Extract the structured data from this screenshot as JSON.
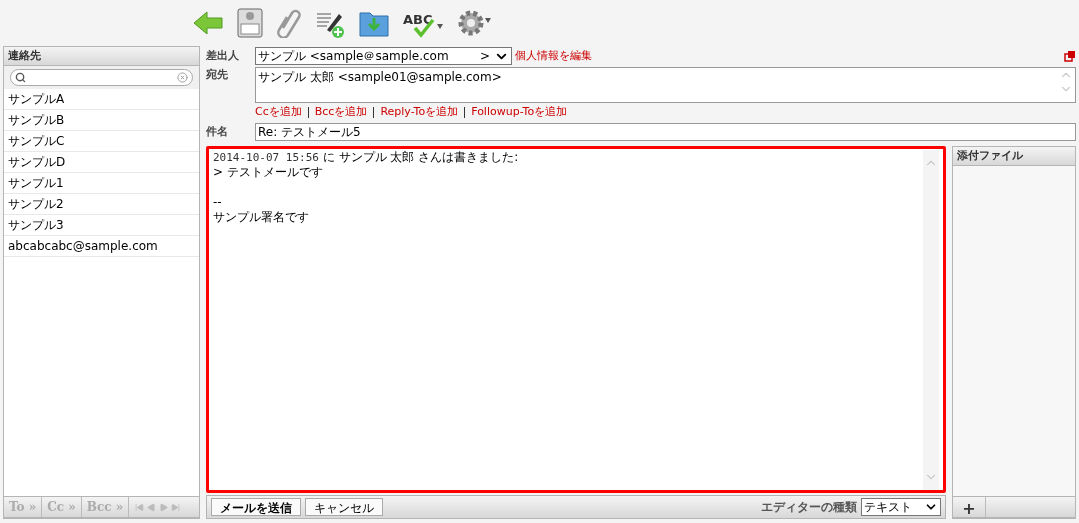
{
  "toolbar": {
    "spellcheck_label": "ABC"
  },
  "contacts": {
    "title": "連絡先",
    "items": [
      {
        "label": "サンプルA",
        "selected": false
      },
      {
        "label": "サンプルB",
        "selected": false
      },
      {
        "label": "サンプルC",
        "selected": false
      },
      {
        "label": "サンプルD",
        "selected": false
      },
      {
        "label": "サンプル1",
        "selected": false
      },
      {
        "label": "サンプル2",
        "selected": false
      },
      {
        "label": "サンプル3",
        "selected": false
      },
      {
        "label": "abcabcabc@sample.com",
        "selected": false
      }
    ],
    "buttons": [
      "To »",
      "Cc »",
      "Bcc »"
    ]
  },
  "from": {
    "label": "差出人",
    "value": "サンプル <sample＠sample.com",
    "suffix": ">",
    "edit_link": "個人情報を編集"
  },
  "to": {
    "label": "宛先",
    "value": "サンプル 太郎 <sample01@sample.com>"
  },
  "add_links": [
    "Ccを追加",
    "Bccを追加",
    "Reply-Toを追加",
    "Followup-Toを追加"
  ],
  "subject": {
    "label": "件名",
    "value": "Re: テストメール5"
  },
  "body": {
    "date": "2014-10-07 15:56",
    "header": "に サンプル 太郎 さんは書きました:",
    "paragraphs": [
      [
        "> テストメールです"
      ],
      [
        "--",
        "サンプル署名です"
      ]
    ]
  },
  "actions": [
    "メールを送信",
    "キャンセル"
  ],
  "editor_type": {
    "label": "エディターの種類",
    "value": "テキスト"
  },
  "attachments": {
    "title": "添付ファイル",
    "add_button": "+"
  }
}
